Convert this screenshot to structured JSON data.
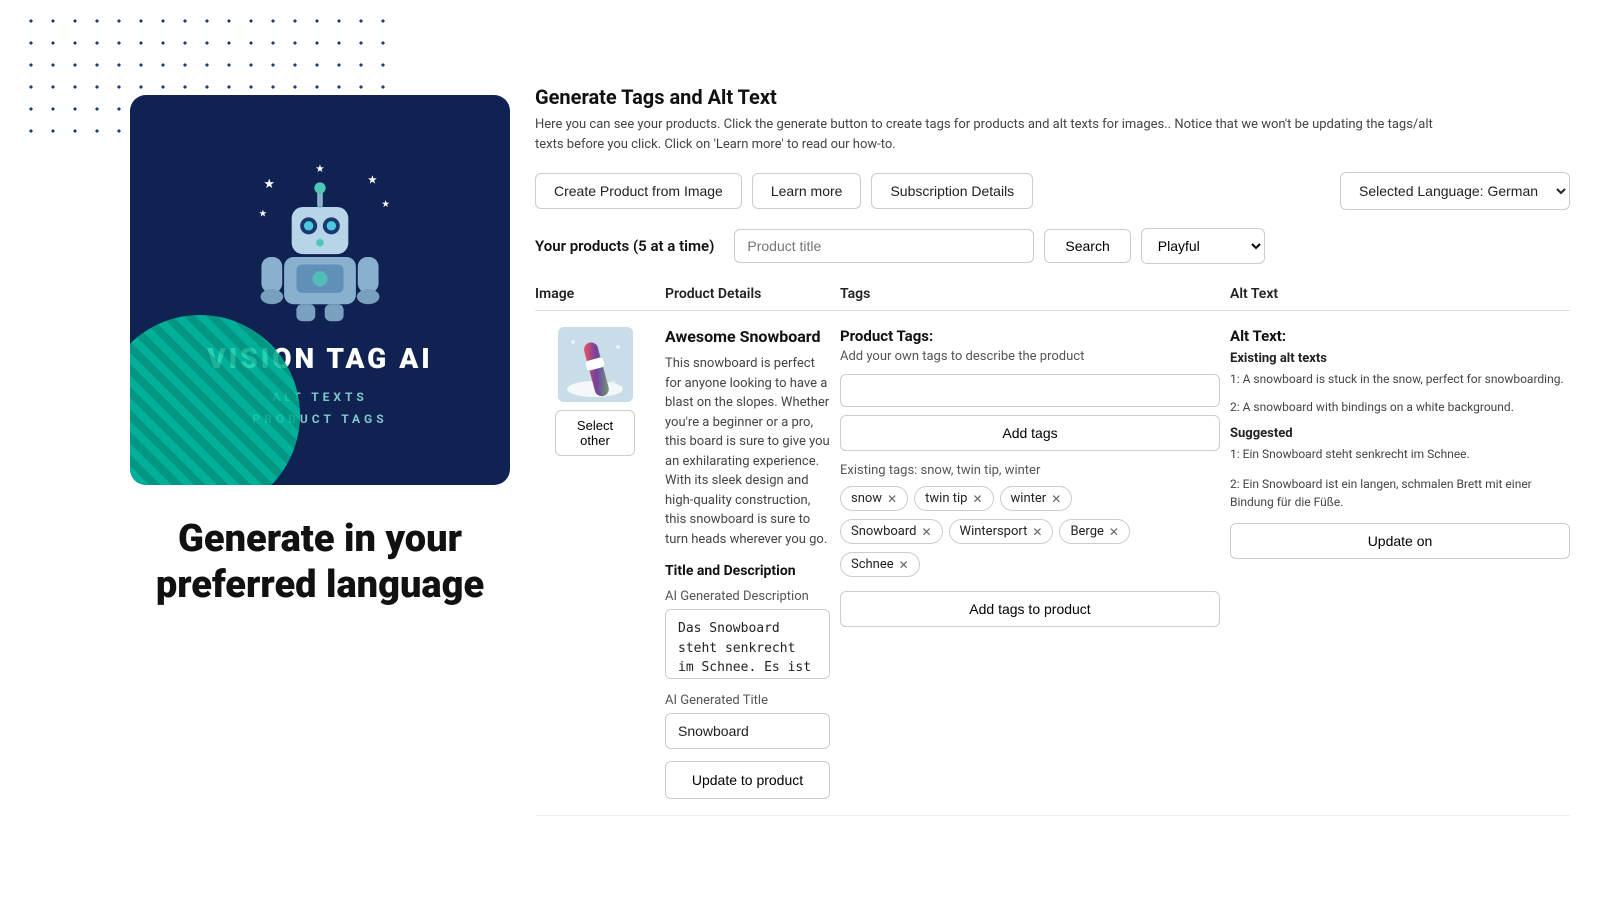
{
  "dotPattern": {},
  "leftPanel": {
    "brandTitle": "VISION TAG AI",
    "brandSubtitle1": "ALT TEXTS",
    "brandSubtitle2": "PRODUCT TAGS",
    "tagline": "Generate in your preferred language"
  },
  "header": {
    "title": "Generate Tags and Alt Text",
    "description": "Here you can see your products. Click the generate button to create tags for products and alt texts for images.. Notice that we won't be updating the tags/alt texts before you click. Click on 'Learn more' to read our how-to.",
    "buttons": {
      "createProduct": "Create Product from Image",
      "learnMore": "Learn more",
      "subscriptionDetails": "Subscription Details",
      "selectedLanguage": "Selected Language: German"
    }
  },
  "productsBar": {
    "label": "Your products (5 at a time)",
    "searchPlaceholder": "Product title",
    "searchBtn": "Search",
    "styleOption": "Playful"
  },
  "tableHeaders": {
    "image": "Image",
    "productDetails": "Product Details",
    "tags": "Tags",
    "altText": "Alt Text"
  },
  "product": {
    "name": "Awesome Snowboard",
    "description": "This snowboard is perfect for anyone looking to have a blast on the slopes. Whether you're a beginner or a pro, this board is sure to give you an exhilarating experience. With its sleek design and high-quality construction, this snowboard is sure to turn heads wherever you go.",
    "selectOther": "Select other",
    "titleAndDesc": "Title and Description",
    "aiGeneratedDescLabel": "AI Generated Description",
    "aiGeneratedDescValue": "Das Snowboard steht senkrecht im Schnee. Es ist ein buntes Board mit weißen Schuhen.",
    "aiGeneratedTitleLabel": "AI Generated Title",
    "aiGeneratedTitleValue": "Snowboard",
    "updateToProduct": "Update to product"
  },
  "tags": {
    "title": "Product Tags:",
    "subtitle": "Add your own tags to describe the product",
    "inputPlaceholder": "",
    "addTagsBtn": "Add tags",
    "existingLabel": "Existing tags: snow, twin tip, winter",
    "chips": [
      {
        "label": "snow"
      },
      {
        "label": "twin tip"
      },
      {
        "label": "winter"
      },
      {
        "label": "Snowboard"
      },
      {
        "label": "Wintersport"
      },
      {
        "label": "Berge"
      },
      {
        "label": "Schnee"
      }
    ],
    "addTagsToProduct": "Add tags to product"
  },
  "altText": {
    "title": "Alt Text:",
    "existingTitle": "Existing alt texts",
    "existing1": "1: A snowboard is stuck in the snow, perfect for snowboarding.",
    "existing2": "2: A snowboard with bindings on a white background.",
    "suggestedTitle": "Suggested",
    "suggested1": "1: Ein Snowboard steht senkrecht im Schnee.",
    "suggested2": "2: Ein Snowboard ist ein langen, schmalen Brett mit einer Bindung für die Füße.",
    "updateOn": "Update on"
  }
}
